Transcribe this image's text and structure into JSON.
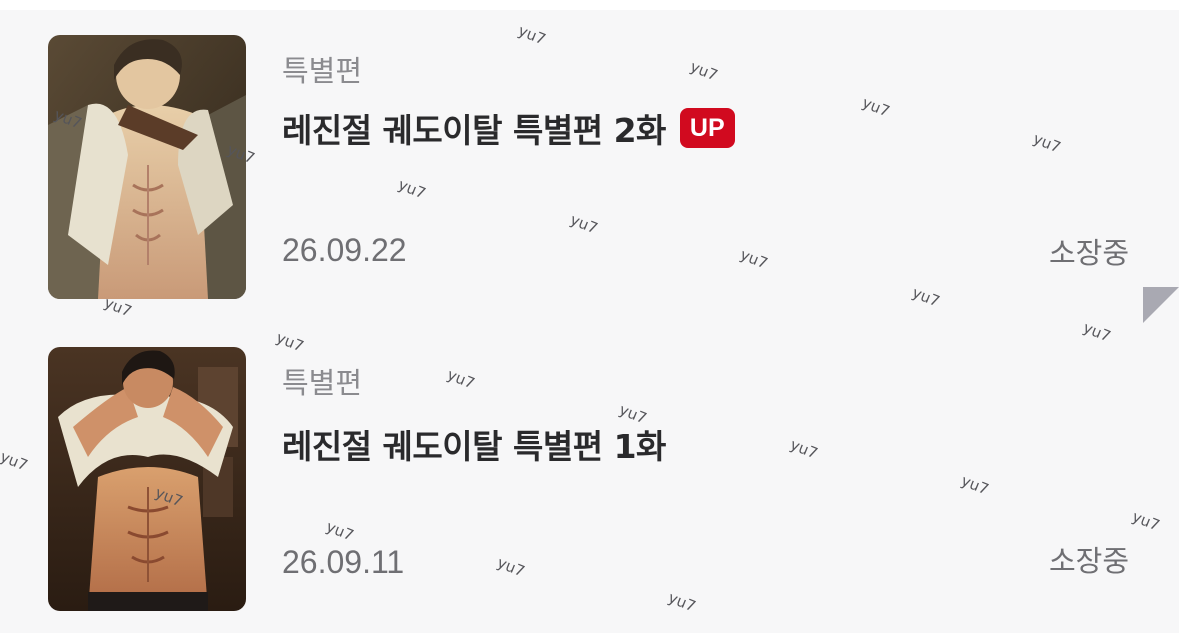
{
  "episodes": [
    {
      "category": "특별편",
      "title": "레진절 궤도이탈 특별편 2화",
      "badge": "UP",
      "date": "26.09.22",
      "status": "소장중"
    },
    {
      "category": "특별편",
      "title": "레진절 궤도이탈 특별편 1화",
      "date": "26.09.11",
      "status": "소장중"
    }
  ],
  "watermark": "yu7",
  "colors": {
    "background": "#f7f7f8",
    "badge": "#d10a1f",
    "category_text": "#8b8b8f",
    "date_text": "#6f6f73",
    "corner_marker": "#a9a9b2"
  }
}
